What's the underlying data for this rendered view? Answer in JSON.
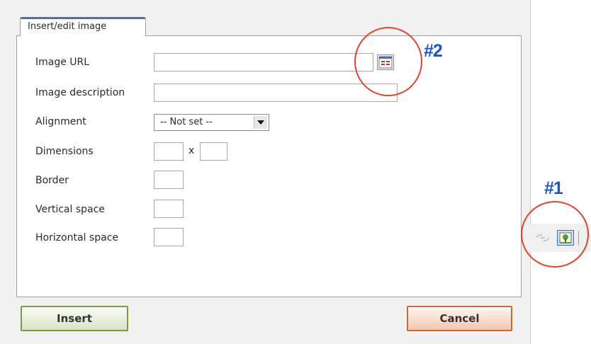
{
  "dialog": {
    "tab_label": "Insert/edit image",
    "fields": {
      "image_url": {
        "label": "Image URL",
        "value": ""
      },
      "image_description": {
        "label": "Image description",
        "value": ""
      },
      "alignment": {
        "label": "Alignment",
        "selected": "-- Not set --"
      },
      "dimensions": {
        "label": "Dimensions",
        "width": "",
        "height": "",
        "separator": "x"
      },
      "border": {
        "label": "Border",
        "value": ""
      },
      "vertical_space": {
        "label": "Vertical space",
        "value": ""
      },
      "horizontal_space": {
        "label": "Horizontal space",
        "value": ""
      }
    },
    "buttons": {
      "insert": "Insert",
      "cancel": "Cancel"
    }
  },
  "annotations": {
    "marker1": "#1",
    "marker2": "#2"
  },
  "colors": {
    "annotation_circle": "#e5432d",
    "annotation_text": "#1a55c9"
  },
  "icons": {
    "browse": "file-browser-icon",
    "image_tool": "insert-image-icon",
    "unlink_tool": "unlink-icon"
  }
}
